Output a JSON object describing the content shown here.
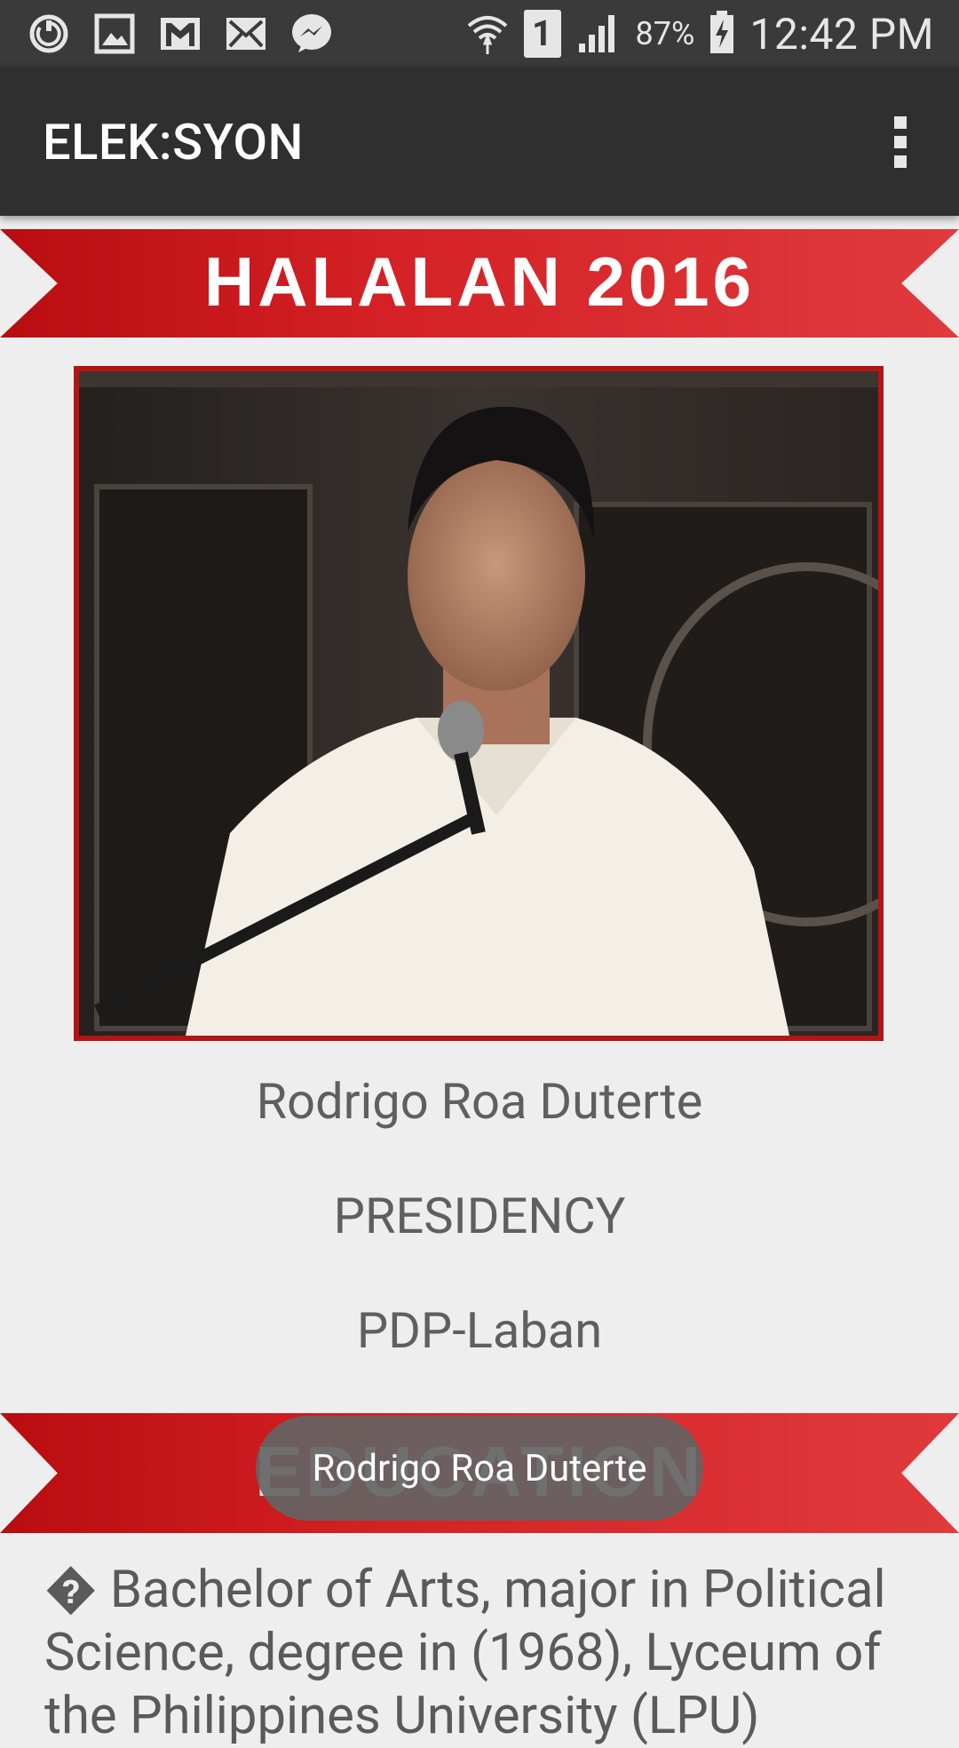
{
  "status_bar": {
    "icons_left": [
      "sync-icon",
      "image-icon",
      "gmail-icon",
      "mail-icon",
      "messenger-icon"
    ],
    "sim_label": "1",
    "battery_percent": "87%",
    "time": "12:42 PM"
  },
  "app_bar": {
    "title": "ELEK:SYON"
  },
  "banner": {
    "title": "HALALAN 2016"
  },
  "candidate": {
    "name": "Rodrigo Roa Duterte",
    "position": "PRESIDENCY",
    "party": "PDP-Laban"
  },
  "section": {
    "title": "EDUCATION"
  },
  "education": {
    "glyph": "�",
    "text": " Bachelor of Arts, major in Political Science, degree in (1968), Lyceum of the Philippines University (LPU)"
  },
  "toast": {
    "message": "Rodrigo Roa Duterte"
  },
  "colors": {
    "status_bar_bg": "#3a3a3a",
    "app_bar_bg": "#2f2f2f",
    "ribbon_red": "#d42125",
    "page_bg": "#eeeeee",
    "text_gray": "#5f5f5f"
  }
}
